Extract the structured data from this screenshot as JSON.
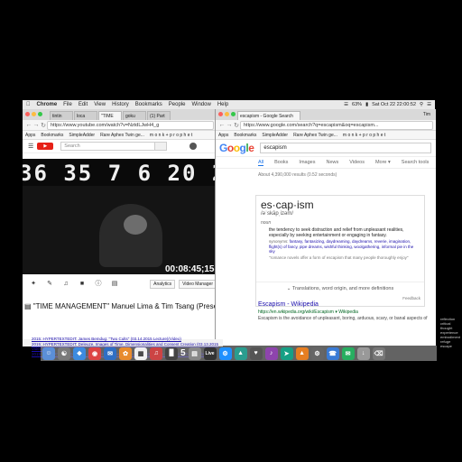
{
  "menubar": {
    "app": "Chrome",
    "items": [
      "File",
      "Edit",
      "View",
      "History",
      "Bookmarks",
      "People",
      "Window",
      "Help"
    ],
    "battery": "63%",
    "datetime": "Sat Oct 22  22:00:52"
  },
  "left_window": {
    "tabs": [
      "tintin",
      "loca",
      "\"TIME",
      "goku",
      "(1) Part"
    ],
    "url": "https://www.youtube.com/watch?v=NztdLJwH4_g",
    "bookmarks": [
      "Apps",
      "Bookmarks",
      "SimpleAdder",
      "Rare Aphex Twin ge...",
      "m o n k + p r o p h e t"
    ],
    "search_placeholder": "Search",
    "logo_text": "YouTube",
    "video": {
      "digits": "36 35 7  6 20 2S",
      "timecode": "00:08:45;15"
    },
    "analytics_label": "Analytics",
    "video_manager_label": "Video Manager",
    "title": "\"TIME MANAGEMENT\" Manuel Lima & Tim Tsang (Presented by"
  },
  "right_window": {
    "url": "https://www.google.com/search?q=escapism&oq=escapism...",
    "user": "Tim",
    "bookmarks": [
      "Apps",
      "Bookmarks",
      "SimpleAdder",
      "Rare Aphex Twin ge...",
      "m o n k + p r o p h e t"
    ],
    "logo": "Google",
    "query": "escapism",
    "tabs": [
      "All",
      "Books",
      "Images",
      "News",
      "Videos",
      "More ▾",
      "Search tools"
    ],
    "result_stats": "About 4,390,000 results (0.52 seconds)",
    "dictionary": {
      "word": "es·cap·ism",
      "pronunciation": "/əˈskāpˌizəm/",
      "part_of_speech": "noun",
      "definition": "the tendency to seek distraction and relief from unpleasant realities, especially by seeking entertainment or engaging in fantasy.",
      "synonyms_label": "synonyms:",
      "synonyms": "fantasy, fantasizing, daydreaming, daydreams, reverie, imagination, flight(s) of fancy, pipe dreams, wishful thinking, woolgathering, informal pie in the sky",
      "example": "\"romance novels offer a form of escapism that many people thoroughly enjoy\"",
      "more": "Translations, word origin, and more definitions",
      "feedback": "Feedback"
    },
    "wiki": {
      "title": "Escapism - Wikipedia",
      "url": "https://en.wikipedia.org/wiki/Escapism ▾  Wikipedia",
      "snippet": "Escapism is the avoidance of unpleasant, boring, arduous, scary, or banal aspects of"
    }
  },
  "background": {
    "links": [
      "2015: HYPERTEXTEDIT: James Bemdug: \"Two Cults\" (03.14.2015 Lecture)(Video)",
      "2015: HYPERTEXTEDIT: Deleuze, Images of Time, Dimensionalities and Consent Creation (03.13.2015 Video)",
      "2015: HYPERTEXTEDIT: Tom Jennings: \"Women Computers\" (03.8.2015 Lecture) 2374% (Video)"
    ],
    "side_notes": [
      "reflection",
      "critical thought",
      "experience",
      "embodiment",
      "refuge",
      "escape"
    ]
  },
  "dock": {
    "number_badge": "5",
    "live_label": "Live"
  },
  "colors": {
    "youtube_red": "#e62117",
    "google_blue": "#4285f4",
    "google_red": "#ea4335",
    "google_yellow": "#fbbc05",
    "google_green": "#34a853",
    "link_blue": "#1a0dab"
  }
}
